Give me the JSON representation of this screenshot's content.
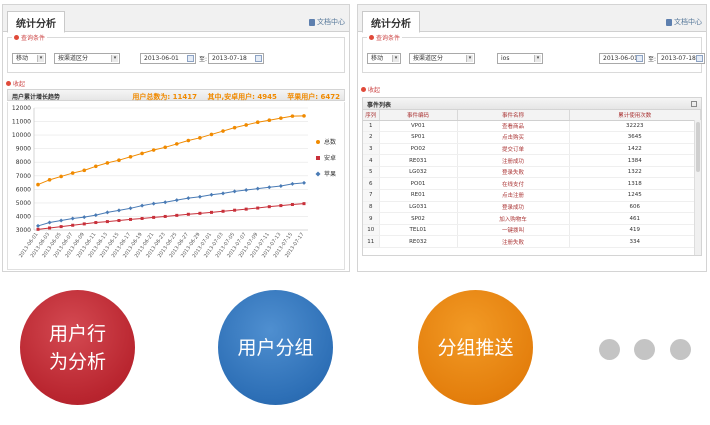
{
  "left_panel": {
    "tab": "统计分析",
    "help": "文档中心",
    "query_legend": "查询条件",
    "filter1": "移动",
    "filter2": "按渠道区分",
    "date_from": "2013-06-01",
    "to_label": "至:",
    "date_to": "2013-07-18",
    "collapse": "收起",
    "chart_title": "用户累计增长趋势",
    "stat_total": "用户总数为: 11417",
    "stat_android": "其中,安卓用户: 4945",
    "stat_ios": "苹果用户: 6472"
  },
  "right_panel": {
    "tab": "统计分析",
    "help": "文档中心",
    "query_legend": "查询条件",
    "filter1": "移动",
    "filter2": "按渠道区分",
    "filter3": "ios",
    "date_from": "2013-06-01",
    "to_label": "至:",
    "date_to": "2013-07-18",
    "collapse": "收起",
    "table_title": "事件列表",
    "columns": [
      "序列",
      "事件编码",
      "事件名称",
      "累计使用次数"
    ],
    "rows": [
      [
        "1",
        "VP01",
        "查看商品",
        "32223"
      ],
      [
        "2",
        "SP01",
        "点击购买",
        "3645"
      ],
      [
        "3",
        "PO02",
        "提交订单",
        "1422"
      ],
      [
        "4",
        "RE031",
        "注册成功",
        "1384"
      ],
      [
        "5",
        "LG032",
        "登录失败",
        "1322"
      ],
      [
        "6",
        "PO01",
        "在线支付",
        "1318"
      ],
      [
        "7",
        "RE01",
        "点击注册",
        "1245"
      ],
      [
        "8",
        "LG031",
        "登录成功",
        "606"
      ],
      [
        "9",
        "SP02",
        "加入购物车",
        "461"
      ],
      [
        "10",
        "TEL01",
        "一键拨叫",
        "419"
      ],
      [
        "11",
        "RE032",
        "注册失败",
        "334"
      ]
    ]
  },
  "features": {
    "user_behavior": "用户行\n为分析",
    "user_group": "用户分组",
    "group_push": "分组推送"
  },
  "colors": {
    "total": "#f08a00",
    "android": "#c8303a",
    "ios": "#4a7bb5",
    "c1": "#b9252f",
    "c2": "#2d6fb6",
    "c3": "#e47f0d"
  },
  "chart_data": {
    "type": "line",
    "ylim": [
      3000,
      12000
    ],
    "yticks": [
      3000,
      4000,
      5000,
      6000,
      7000,
      8000,
      9000,
      10000,
      11000,
      12000
    ],
    "x": [
      "2013-06-01",
      "2013-06-03",
      "2013-06-05",
      "2013-06-07",
      "2013-06-09",
      "2013-06-11",
      "2013-06-13",
      "2013-06-15",
      "2013-06-17",
      "2013-06-19",
      "2013-06-21",
      "2013-06-23",
      "2013-06-25",
      "2013-06-27",
      "2013-06-29",
      "2013-07-01",
      "2013-07-03",
      "2013-07-05",
      "2013-07-07",
      "2013-07-09",
      "2013-07-11",
      "2013-07-13",
      "2013-07-15",
      "2013-07-17"
    ],
    "series": [
      {
        "name": "总数",
        "values": [
          6350,
          6700,
          6950,
          7200,
          7400,
          7700,
          7950,
          8150,
          8400,
          8650,
          8900,
          9100,
          9350,
          9600,
          9800,
          10050,
          10300,
          10550,
          10750,
          10950,
          11100,
          11250,
          11400,
          11417
        ]
      },
      {
        "name": "安卓",
        "values": [
          3050,
          3150,
          3250,
          3350,
          3450,
          3550,
          3620,
          3700,
          3780,
          3850,
          3930,
          4000,
          4080,
          4160,
          4230,
          4300,
          4380,
          4460,
          4540,
          4620,
          4720,
          4800,
          4880,
          4945
        ]
      },
      {
        "name": "苹果",
        "values": [
          3300,
          3550,
          3700,
          3850,
          3950,
          4100,
          4300,
          4450,
          4600,
          4800,
          4950,
          5050,
          5200,
          5350,
          5450,
          5600,
          5700,
          5850,
          5950,
          6050,
          6150,
          6250,
          6400,
          6472
        ]
      }
    ]
  }
}
